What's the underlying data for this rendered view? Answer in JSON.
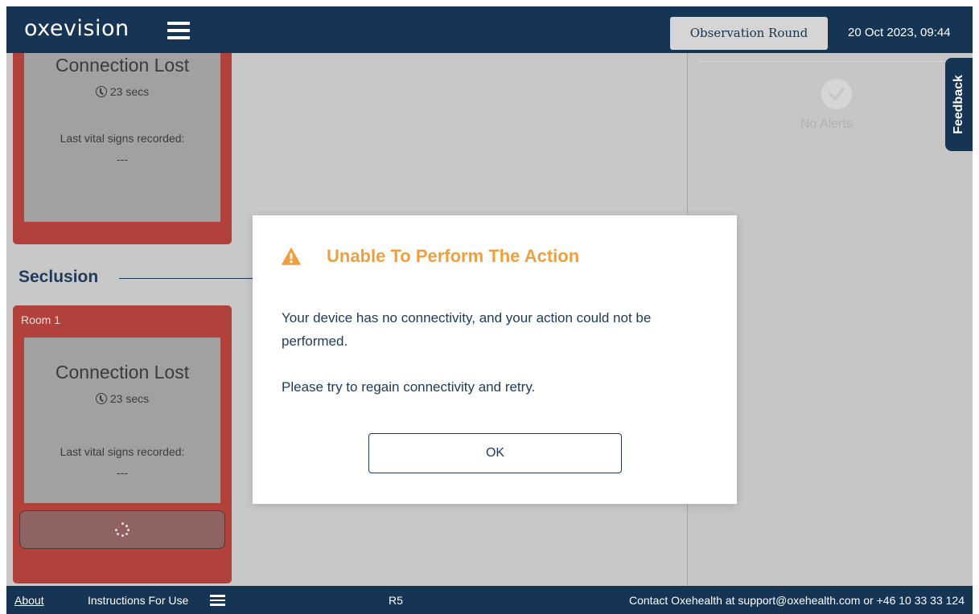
{
  "colors": {
    "navy": "#163453",
    "room_card_red": "#b2403b",
    "warning_orange": "#eea03f",
    "text_navy": "#1e3a56"
  },
  "header": {
    "logo": "oxevision",
    "menu_icon": "hamburger-icon",
    "observation_round_label": "Observation Round",
    "datetime": "20 Oct 2023, 09:44"
  },
  "rooms": [
    {
      "room_label": "",
      "status": "Connection Lost",
      "timer": "23 secs",
      "vitals_label": "Last vital signs recorded:",
      "vitals_value": "---"
    },
    {
      "section": "Seclusion",
      "room_label": "Room 1",
      "status": "Connection Lost",
      "timer": "23 secs",
      "vitals_label": "Last vital signs recorded:",
      "vitals_value": "---",
      "action_state": "loading"
    }
  ],
  "alerts_panel": {
    "icon": "check-circle-icon",
    "empty_text": "No Alerts"
  },
  "feedback_tab": "Feedback",
  "dialog": {
    "icon": "warning-icon",
    "title": "Unable To Perform The Action",
    "message_1": "Your device has no connectivity, and your action could not be performed.",
    "message_2": "Please try to regain connectivity and retry.",
    "ok_label": "OK"
  },
  "footer": {
    "about": "About",
    "instructions": "Instructions For Use",
    "version": "R5",
    "contact": "Contact Oxehealth at support@oxehealth.com or +46 10 33 33 124"
  }
}
